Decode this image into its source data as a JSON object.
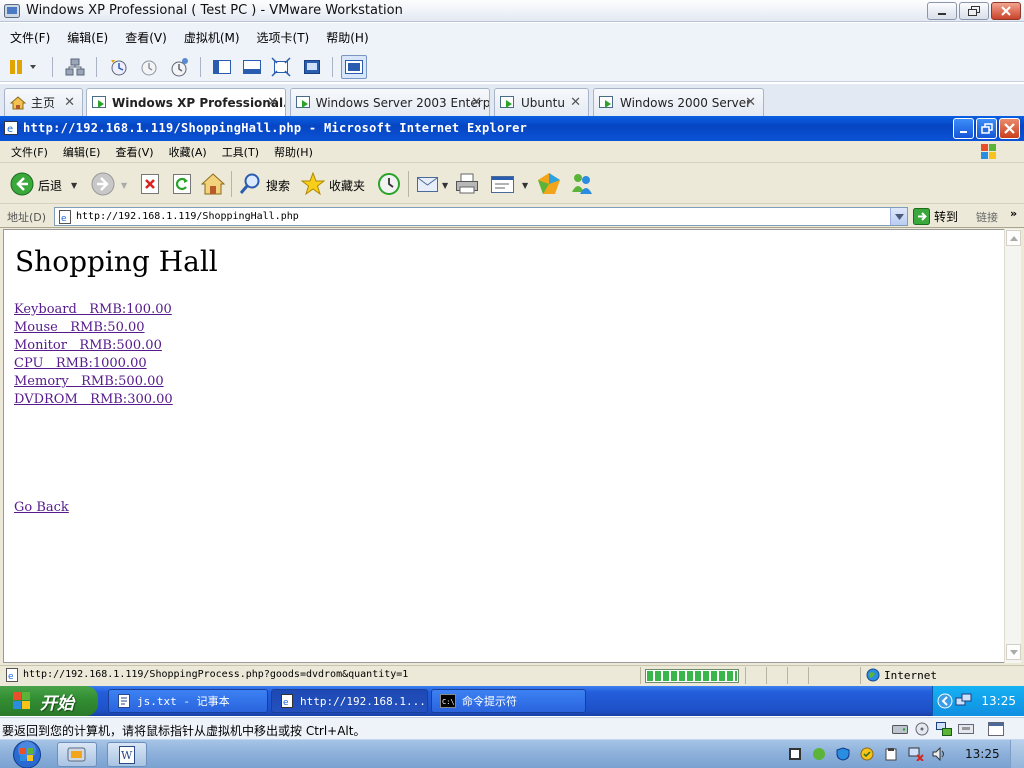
{
  "vmware": {
    "title": "Windows XP Professional ( Test PC ) - VMware Workstation",
    "menu": [
      "文件(F)",
      "编辑(E)",
      "查看(V)",
      "虚拟机(M)",
      "选项卡(T)",
      "帮助(H)"
    ],
    "tabs": [
      {
        "label": "主页",
        "active": false
      },
      {
        "label": "Windows XP Professional...",
        "active": true
      },
      {
        "label": "Windows Server 2003 Enterpr...",
        "active": false
      },
      {
        "label": "Ubuntu",
        "active": false
      },
      {
        "label": "Windows 2000 Server",
        "active": false
      }
    ],
    "status_message": "要返回到您的计算机，请将鼠标指针从虚拟机中移出或按 Ctrl+Alt。"
  },
  "ie": {
    "title": "http://192.168.1.119/ShoppingHall.php - Microsoft Internet Explorer",
    "menu": [
      "文件(F)",
      "编辑(E)",
      "查看(V)",
      "收藏(A)",
      "工具(T)",
      "帮助(H)"
    ],
    "toolbar": {
      "back": "后退",
      "search": "搜索",
      "favorites": "收藏夹"
    },
    "address_label": "地址(D)",
    "address": "http://192.168.1.119/ShoppingHall.php",
    "go_label": "转到",
    "links_label": "链接",
    "more": "»",
    "status_url": "http://192.168.1.119/ShoppingProcess.php?goods=dvdrom&quantity=1",
    "zone": "Internet"
  },
  "page": {
    "heading": "Shopping Hall",
    "products": [
      "Keyboard   RMB:100.00",
      "Mouse   RMB:50.00",
      "Monitor   RMB:500.00",
      "CPU   RMB:1000.00",
      "Memory   RMB:500.00",
      "DVDROM   RMB:300.00"
    ],
    "go_back": "Go Back"
  },
  "xp_taskbar": {
    "start": "开始",
    "tasks": [
      "js.txt - 记事本",
      "http://192.168.1...",
      "命令提示符"
    ],
    "clock": "13:25"
  },
  "host": {
    "clock": "13:25"
  }
}
